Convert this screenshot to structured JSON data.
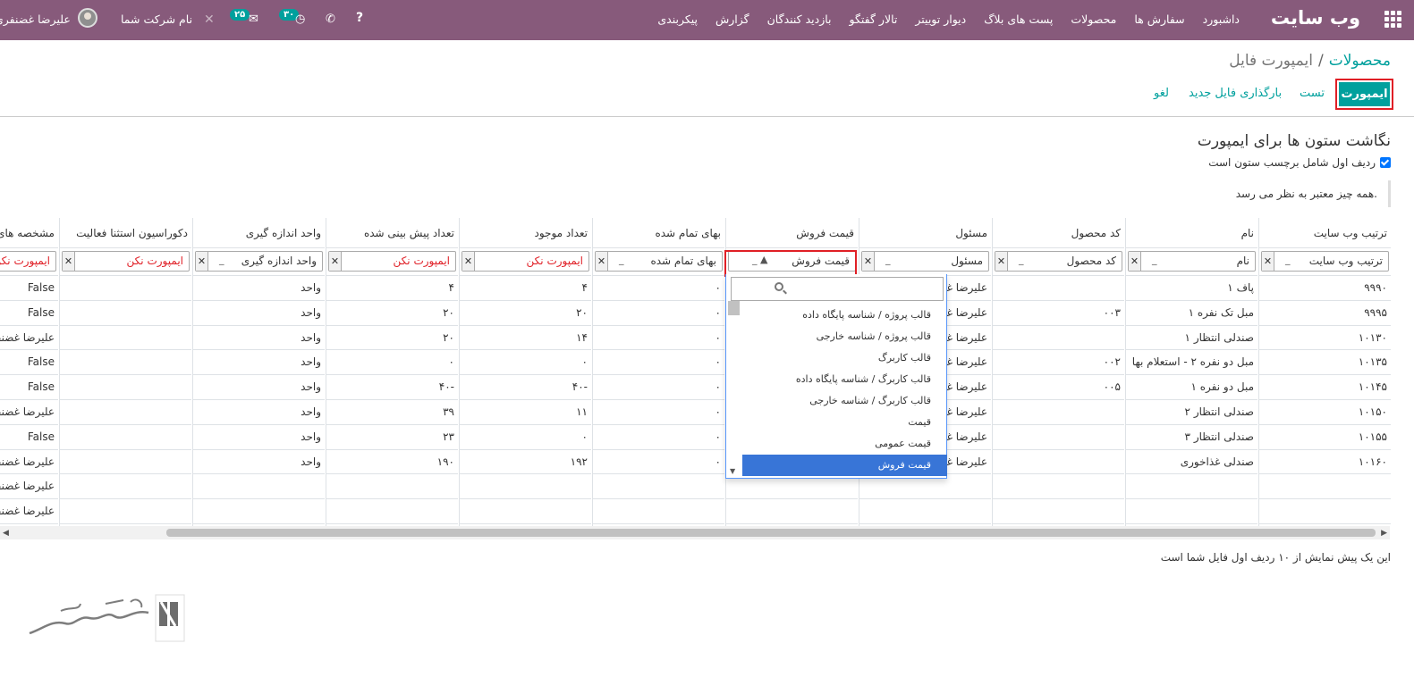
{
  "navbar": {
    "brand": "وب سایت",
    "menu": [
      "داشبورد",
      "سفارش ها",
      "محصولات",
      "پست های بلاگ",
      "دیوار توییتر",
      "تالار گفتگو",
      "بازدید کنندگان",
      "گزارش",
      "پیکربندی"
    ],
    "user_name": "علیرضا غضنفری",
    "company": "نام شرکت شما",
    "messages_count": "۲۵",
    "activities_count": "۳۰"
  },
  "breadcrumb": {
    "parent": "محصولات",
    "current": "ایمپورت فایل"
  },
  "buttons": {
    "import": "ایمپورت",
    "test": "تست",
    "load_new": "بارگذاری فایل جدید",
    "cancel": "لغو"
  },
  "mapping": {
    "title": "نگاشت ستون ها برای ایمپورت",
    "header_option": "ردیف اول شامل برچسب ستون است",
    "header_option_checked": true,
    "valid_message": "همه چیز معتبر به نظر می رسد."
  },
  "columns": [
    {
      "header": "ترتیب وب سایت",
      "select": "ترتیب وب سایت",
      "cells": [
        "۹۹۹۰",
        "۹۹۹۵",
        "۱۰۱۳۰",
        "۱۰۱۳۵",
        "۱۰۱۴۵",
        "۱۰۱۵۰",
        "۱۰۱۵۵",
        "۱۰۱۶۰",
        "",
        ""
      ]
    },
    {
      "header": "نام",
      "select": "نام",
      "cells": [
        "پاف ۱",
        "مبل تک نفره ۱",
        "صندلی انتظار ۱",
        "مبل دو نفره ۲ - استعلام بها",
        "مبل دو نفره ۱",
        "صندلی انتظار ۲",
        "صندلی انتظار ۳",
        "صندلی غذاخوری",
        "",
        ""
      ]
    },
    {
      "header": "کد محصول",
      "select": "کد محصول",
      "cells": [
        "",
        "۰۰۳",
        "",
        "۰۰۲",
        "۰۰۵",
        "",
        "",
        "",
        "",
        ""
      ]
    },
    {
      "header": "مسئول",
      "select": "مسئول",
      "cells": [
        "علیرضا غضنفری",
        "علیرضا غضنفری",
        "علیرضا غضنفری",
        "علیرضا غضنفری",
        "علیرضا غضنفری",
        "علیرضا غضنفری",
        "علیرضا غضنفری",
        "علیرضا غضنفری",
        "",
        ""
      ]
    },
    {
      "header": "قیمت فروش",
      "select": "قیمت فروش",
      "cells": [
        "",
        "",
        "",
        "",
        "",
        "",
        "",
        "",
        "",
        ""
      ]
    },
    {
      "header": "بهای تمام شده",
      "select": "بهای تمام شده",
      "cells": [
        "۰",
        "۰",
        "۰",
        "۰",
        "۰",
        "۰",
        "۰",
        "۰",
        "",
        ""
      ]
    },
    {
      "header": "تعداد موجود",
      "select": "ایمپورت نکن",
      "cells": [
        "۴",
        "۲۰",
        "۱۴",
        "۰",
        "-۴۰",
        "۱۱",
        "۰",
        "۱۹۲",
        "",
        ""
      ]
    },
    {
      "header": "تعداد پیش بینی شده",
      "select": "ایمپورت نکن",
      "cells": [
        "۴",
        "۲۰",
        "۲۰",
        "۰",
        "-۴۰",
        "۳۹",
        "۲۳",
        "۱۹۰",
        "",
        ""
      ]
    },
    {
      "header": "واحد اندازه گیری",
      "select": "واحد اندازه گیری",
      "cells": [
        "واحد",
        "واحد",
        "واحد",
        "واحد",
        "واحد",
        "واحد",
        "واحد",
        "واحد",
        "",
        ""
      ]
    },
    {
      "header": "دکوراسیون استثنا فعالیت",
      "select": "ایمپورت نکن",
      "cells": [
        "",
        "",
        "",
        "",
        "",
        "",
        "",
        "",
        "",
        ""
      ]
    },
    {
      "header": "مشخصه های",
      "select": "ایمپورت نکن",
      "cells": [
        "False",
        "False",
        "علیرضا غضنفری",
        "False",
        "False",
        "علیرضا غضنفری",
        "False",
        "علیرضا غضنفری",
        "علیرضا غضنفری",
        "علیرضا غضنفری"
      ]
    }
  ],
  "dropdown": {
    "items": [
      "قالب پروژه / شناسه پایگاه داده",
      "قالب پروژه / شناسه خارجی",
      "قالب کاربرگ",
      "قالب کاربرگ / شناسه پایگاه داده",
      "قالب کاربرگ / شناسه خارجی",
      "قیمت",
      "قیمت عمومی",
      "قیمت فروش"
    ],
    "selected": "قیمت فروش"
  },
  "preview_note": "این یک پیش نمایش از ۱۰ ردیف اول فایل شما است",
  "colors": {
    "navbar": "#875a7b",
    "accent": "#00a09d",
    "highlight": "#e01f26",
    "dropdown_active": "#3875d7"
  }
}
